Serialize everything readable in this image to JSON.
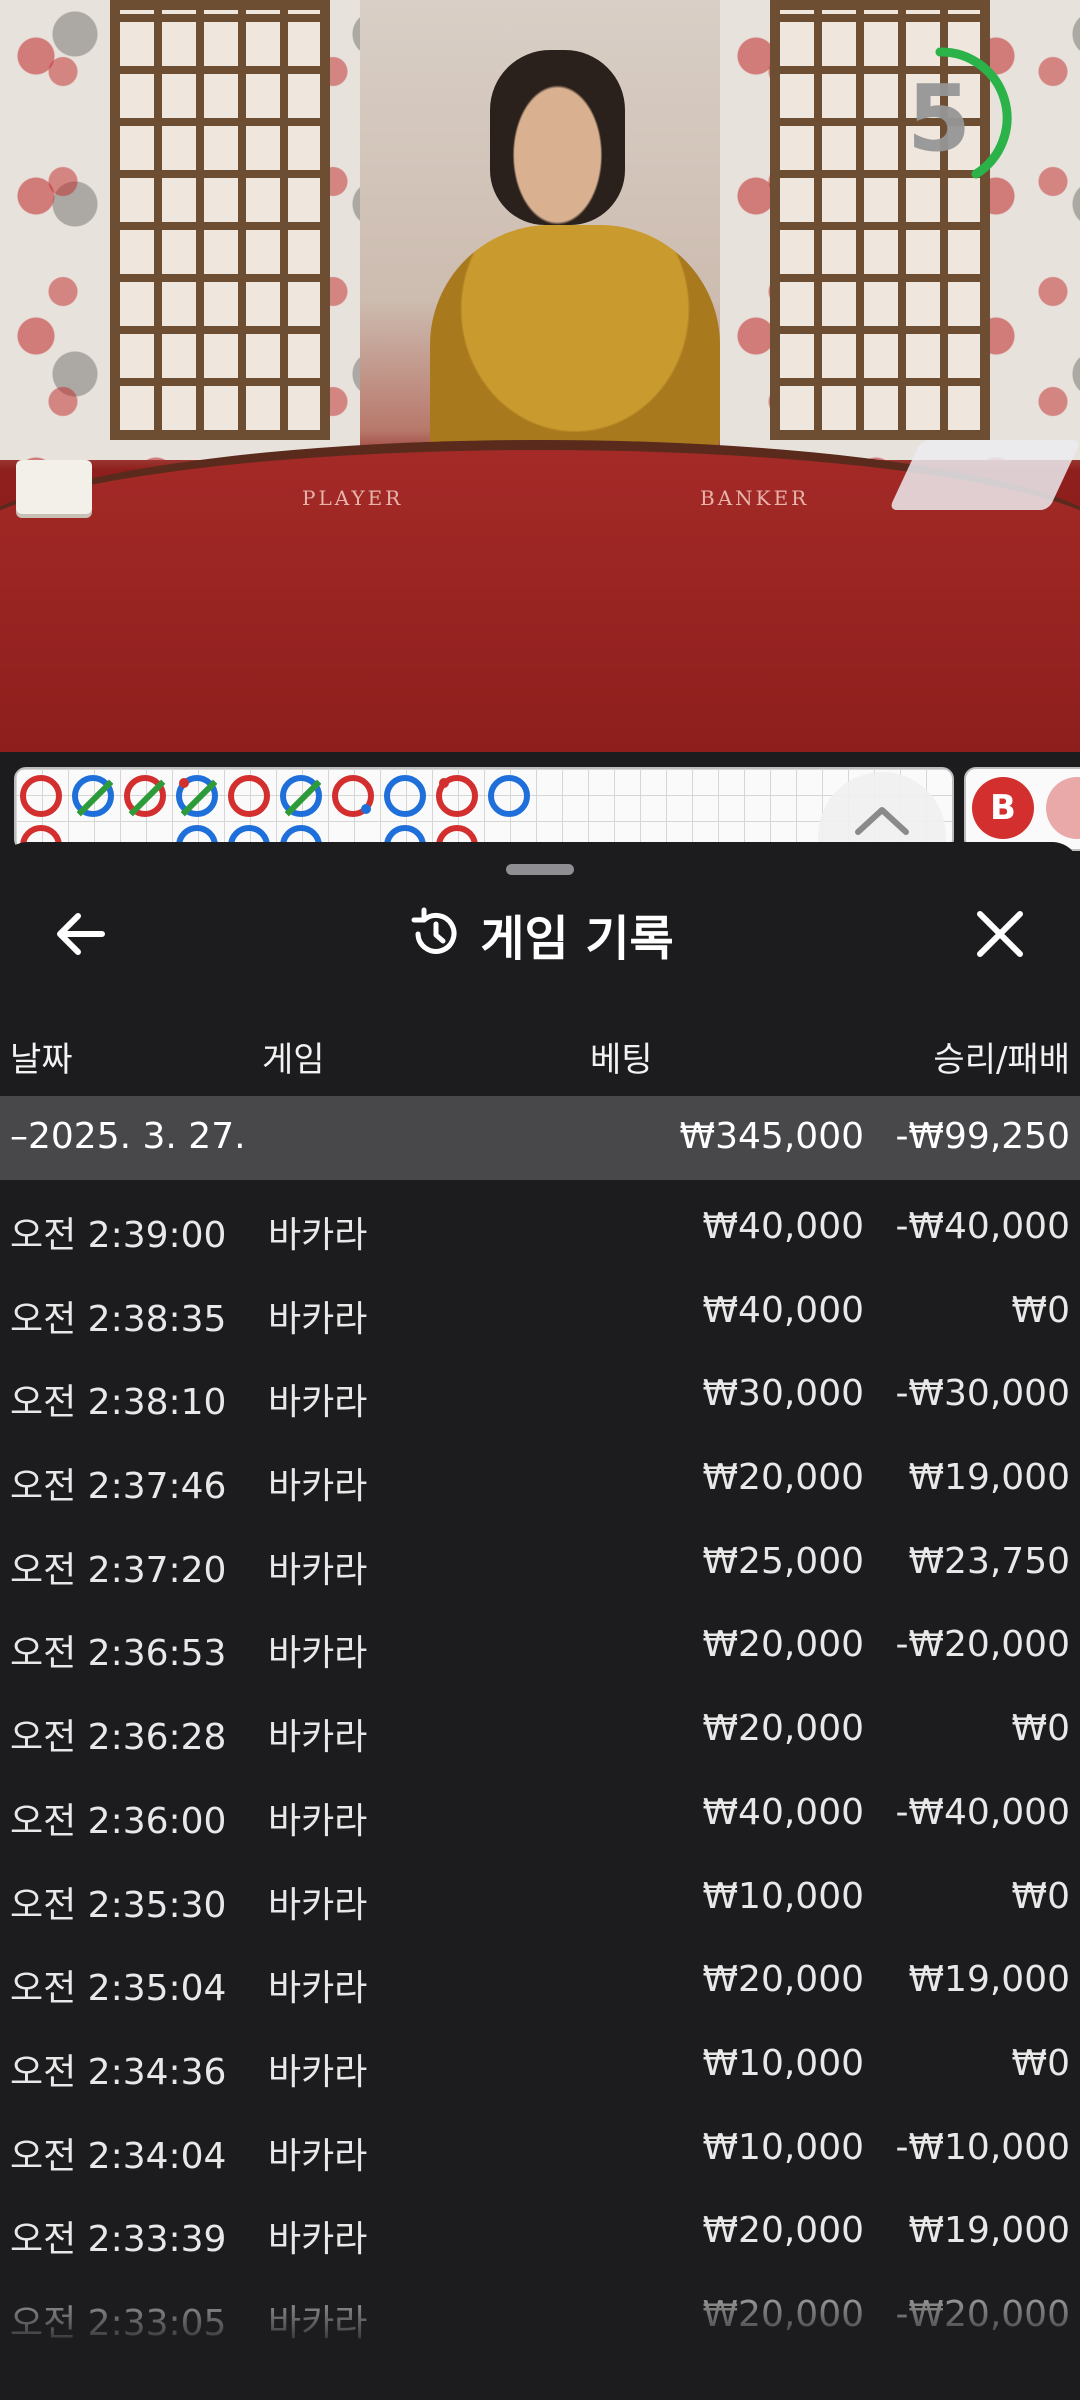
{
  "video": {
    "table_labels": {
      "player": "PLAYER",
      "banker": "BANKER"
    },
    "countdown": {
      "value": "5",
      "ring_color": "#2bb34a"
    }
  },
  "roadmap": {
    "top_row": [
      "banker",
      "player-tie",
      "banker-tie",
      "player-tie",
      "banker",
      "player-tie",
      "banker-pair",
      "player",
      "player-pair",
      "player"
    ],
    "badge": "B"
  },
  "sheet": {
    "title": "게임 기록",
    "icons": {
      "back": "arrow-left-icon",
      "history": "history-icon",
      "close": "close-icon"
    },
    "columns": {
      "date": "날짜",
      "game": "게임",
      "bet": "베팅",
      "result": "승리/패배"
    },
    "date_group": {
      "date": "–2025. 3. 27.",
      "bet_total": "₩345,000",
      "result_total": "-₩99,250"
    },
    "rows": [
      {
        "time": "오전 2:39:00",
        "game": "바카라",
        "bet": "₩40,000",
        "result": "-₩40,000"
      },
      {
        "time": "오전 2:38:35",
        "game": "바카라",
        "bet": "₩40,000",
        "result": "₩0"
      },
      {
        "time": "오전 2:38:10",
        "game": "바카라",
        "bet": "₩30,000",
        "result": "-₩30,000"
      },
      {
        "time": "오전 2:37:46",
        "game": "바카라",
        "bet": "₩20,000",
        "result": "₩19,000"
      },
      {
        "time": "오전 2:37:20",
        "game": "바카라",
        "bet": "₩25,000",
        "result": "₩23,750"
      },
      {
        "time": "오전 2:36:53",
        "game": "바카라",
        "bet": "₩20,000",
        "result": "-₩20,000"
      },
      {
        "time": "오전 2:36:28",
        "game": "바카라",
        "bet": "₩20,000",
        "result": "₩0"
      },
      {
        "time": "오전 2:36:00",
        "game": "바카라",
        "bet": "₩40,000",
        "result": "-₩40,000"
      },
      {
        "time": "오전 2:35:30",
        "game": "바카라",
        "bet": "₩10,000",
        "result": "₩0"
      },
      {
        "time": "오전 2:35:04",
        "game": "바카라",
        "bet": "₩20,000",
        "result": "₩19,000"
      },
      {
        "time": "오전 2:34:36",
        "game": "바카라",
        "bet": "₩10,000",
        "result": "₩0"
      },
      {
        "time": "오전 2:34:04",
        "game": "바카라",
        "bet": "₩10,000",
        "result": "-₩10,000"
      },
      {
        "time": "오전 2:33:39",
        "game": "바카라",
        "bet": "₩20,000",
        "result": "₩19,000"
      },
      {
        "time": "오전 2:33:05",
        "game": "바카라",
        "bet": "₩20,000",
        "result": "-₩20,000"
      }
    ]
  }
}
